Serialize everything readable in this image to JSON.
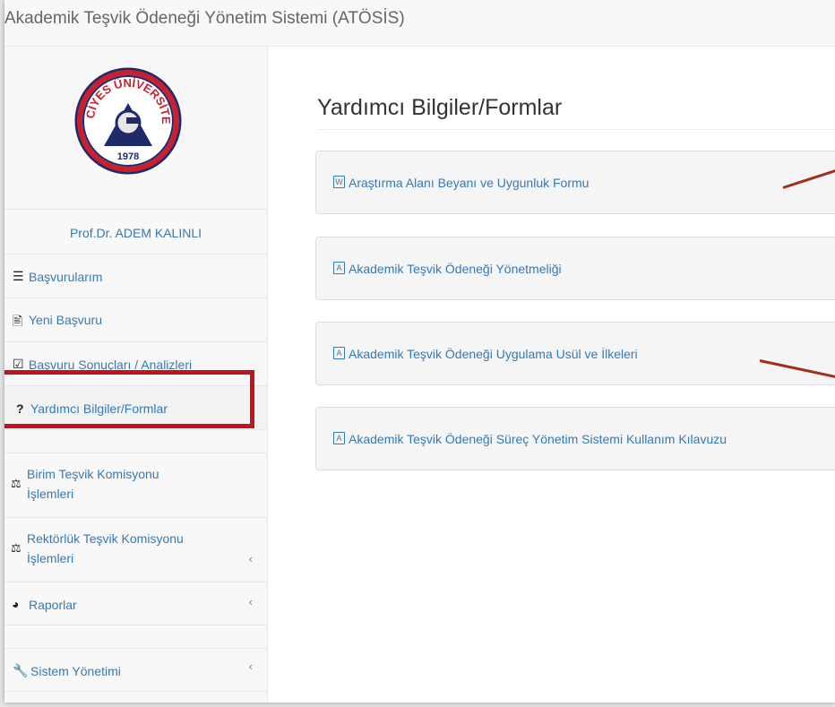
{
  "app": {
    "title": "Akademik Teşvik Ödeneği Yönetim Sistemi (ATÖSİS)"
  },
  "logo": {
    "top_text": "ERCİYES ÜNİVERSİTESİ",
    "year": "1978"
  },
  "user": {
    "name": "Prof.Dr. ADEM KALINLI"
  },
  "sidebar": {
    "items": [
      {
        "label": "Başvurularım",
        "icon": "list-icon"
      },
      {
        "label": "Yeni Başvuru",
        "icon": "document-icon"
      },
      {
        "label": "Başvuru Sonuçları / Analizleri",
        "icon": "checkbox-icon"
      },
      {
        "label": "Yardımcı Bilgiler/Formlar",
        "icon": "question-icon"
      },
      {
        "label_line1": "Birim Teşvik Komisyonu",
        "label_line2": "İşlemleri",
        "icon": "balance-scale-icon"
      },
      {
        "label_line1": "Rektörlük Teşvik Komisyonu",
        "label_line2": "İşlemleri",
        "icon": "balance-scale-icon"
      },
      {
        "label": "Raporlar",
        "icon": "dashboard-icon"
      },
      {
        "label": "Sistem Yönetimi",
        "icon": "wrench-icon"
      }
    ]
  },
  "main": {
    "title": "Yardımcı Bilgiler/Formlar",
    "documents": [
      {
        "label": "Araştırma Alanı Beyanı ve Uygunluk Formu",
        "icon": "word-file-icon"
      },
      {
        "label": "Akademik Teşvik Ödeneği Yönetmeliği",
        "icon": "pdf-file-icon"
      },
      {
        "label": "Akademik Teşvik Ödeneği Uygulama Usül ve İlkeleri",
        "icon": "pdf-file-icon"
      },
      {
        "label": "Akademik Teşvik Ödeneği Süreç Yönetim Sistemi Kullanım Kılavuzu",
        "icon": "pdf-file-icon"
      }
    ]
  },
  "colors": {
    "link": "#337ab7",
    "highlight": "#c1121f",
    "annotation_arrow": "#a0301c"
  }
}
